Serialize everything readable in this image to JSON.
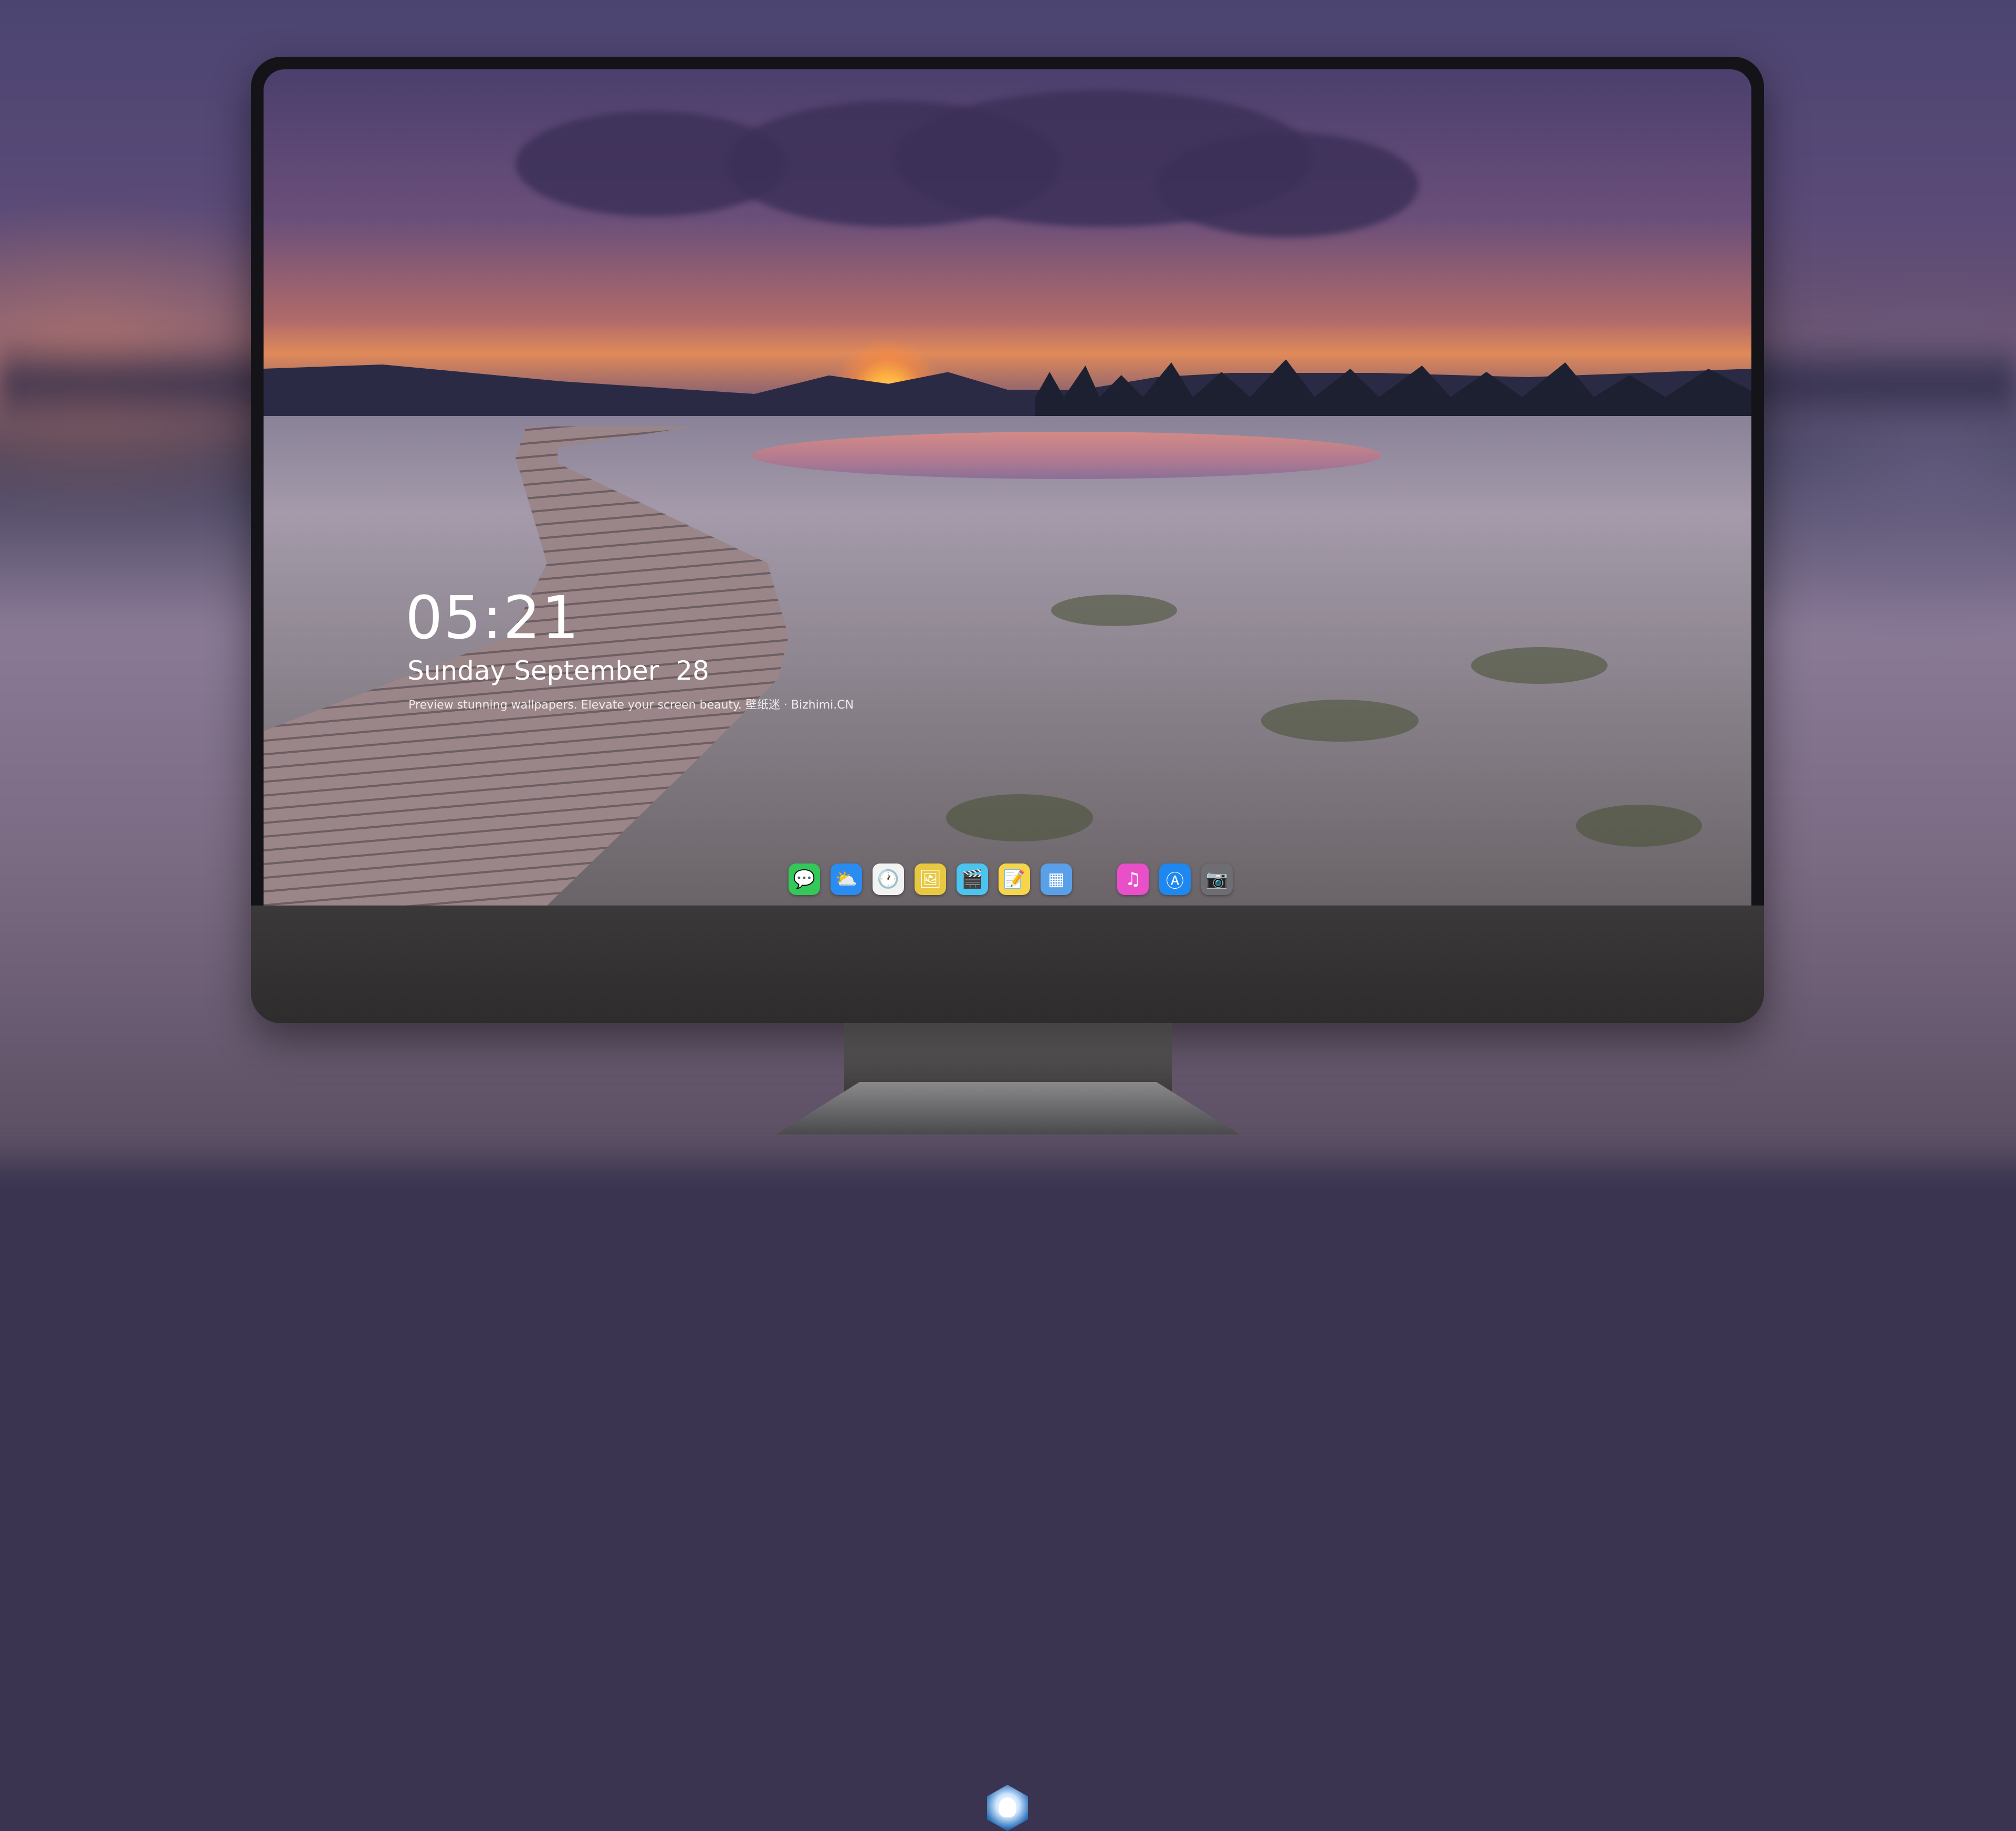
{
  "lockscreen": {
    "time": "05:21",
    "date": "Sunday September  28",
    "tagline": "Preview stunning wallpapers. Elevate your screen beauty. 壁纸迷 · Bizhimi.CN"
  },
  "dock": {
    "apps": [
      {
        "name": "messages",
        "glyph": "💬",
        "color": "#34c759"
      },
      {
        "name": "weather",
        "glyph": "⛅",
        "color": "#2a8cf0"
      },
      {
        "name": "clock",
        "glyph": "🕐",
        "color": "#f2f2f2"
      },
      {
        "name": "preview",
        "glyph": "🖼",
        "color": "#e8c840"
      },
      {
        "name": "clips",
        "glyph": "🎬",
        "color": "#4cc4f0"
      },
      {
        "name": "notes",
        "glyph": "📝",
        "color": "#f7d54a"
      },
      {
        "name": "photos-grid",
        "glyph": "▦",
        "color": "#5aa0e8"
      },
      {
        "name": "music",
        "glyph": "♫",
        "color": "#e84fc8"
      },
      {
        "name": "app-store",
        "glyph": "Ⓐ",
        "color": "#1e88f0"
      },
      {
        "name": "camera",
        "glyph": "📷",
        "color": "#6e6e72"
      }
    ]
  },
  "colors": {
    "bezel": "#141418",
    "chin": "#2e2c2c",
    "text": "#ffffff"
  }
}
